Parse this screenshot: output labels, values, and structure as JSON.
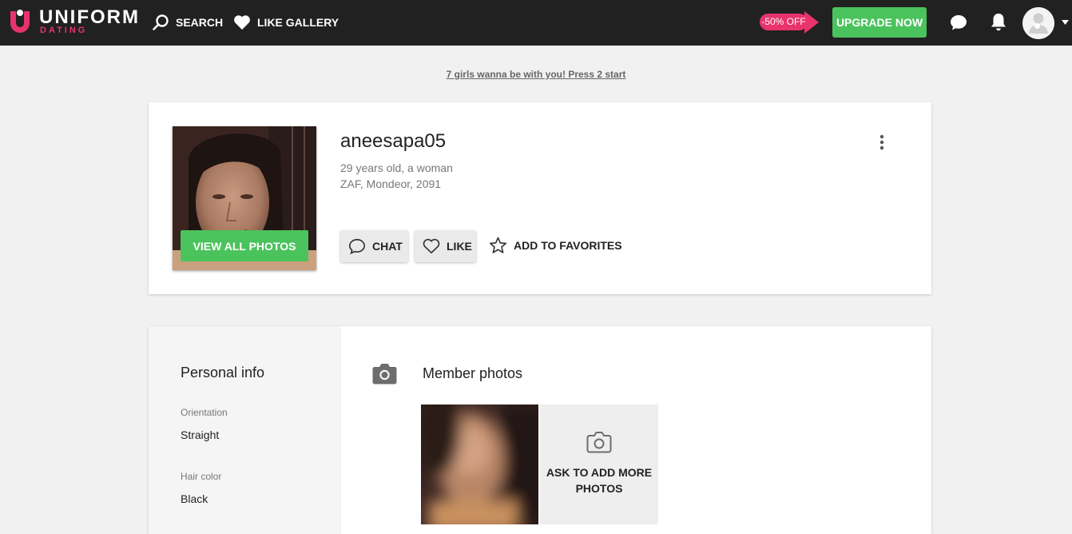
{
  "app": {
    "logo_word": "UNIFORM",
    "logo_sub": "DATING",
    "brand_color": "#e8336d",
    "accent_green": "#4bc35d"
  },
  "nav": {
    "search_label": "SEARCH",
    "like_gallery_label": "LIKE GALLERY",
    "promo_badge": "-50% OFF",
    "upgrade_label": "UPGRADE NOW"
  },
  "banner": {
    "link_text": "7 girls wanna be with you! Press 2 start"
  },
  "profile": {
    "username": "aneesapa05",
    "age_gender": "29 years old, a woman",
    "location": "ZAF, Mondeor, 2091",
    "view_photos_label": "VIEW ALL PHOTOS",
    "chat_label": "CHAT",
    "like_label": "LIKE",
    "favorites_label": "ADD TO FAVORITES"
  },
  "personal_info": {
    "title": "Personal info",
    "fields": [
      {
        "label": "Orientation",
        "value": "Straight"
      },
      {
        "label": "Hair color",
        "value": "Black"
      }
    ]
  },
  "member_photos": {
    "title": "Member photos",
    "ask_more_label": "ASK TO ADD MORE PHOTOS"
  }
}
